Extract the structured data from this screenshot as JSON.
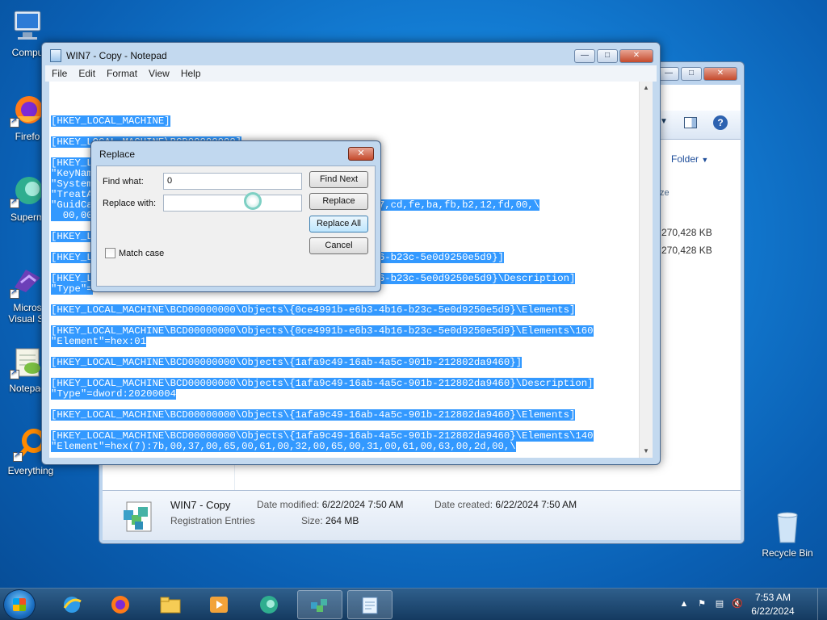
{
  "desktop": {
    "icons": [
      {
        "label": "Compu",
        "icon": "computer-icon"
      },
      {
        "label": "Firefo",
        "icon": "firefox-icon"
      },
      {
        "label": "Superm",
        "icon": "supermium-icon"
      },
      {
        "label": "Micros",
        "label2": "Visual St",
        "icon": "visual-studio-icon"
      },
      {
        "label": "Notepad",
        "icon": "notepad-plus-icon"
      },
      {
        "label": "Everything",
        "icon": "everything-icon"
      },
      {
        "label": "Recycle Bin",
        "icon": "recycle-bin-icon"
      }
    ]
  },
  "explorer": {
    "toolbar_folder": "Folder",
    "size_header": "ze",
    "rows": [
      "270,428 KB",
      "270,428 KB"
    ],
    "details": {
      "name": "WIN7 - Copy",
      "type": "Registration Entries",
      "modified_label": "Date modified:",
      "modified": "6/22/2024 7:50 AM",
      "created_label": "Date created:",
      "created": "6/22/2024 7:50 AM",
      "size_label": "Size:",
      "size": "264 MB"
    }
  },
  "notepad": {
    "title": "WIN7 - Copy - Notepad",
    "menu": [
      "File",
      "Edit",
      "Format",
      "View",
      "Help"
    ],
    "lines": [
      "",
      "[HKEY_LOCAL_MACHINE]",
      "",
      "[HKEY_LOCAL_MACHINE\\BCD00000000]",
      "",
      "[HKEY_L",
      "\"KeyNam",
      "\"System",
      "\"TreatA",
      "\"GuidCa                                              ,a7,cd,fe,ba,fb,b2,12,fd,00,\\",
      "  00,00",
      "",
      "[HKEY_L",
      "",
      "[HKEY_L                                         6b3-4b16-b23c-5e0d9250e5d9}]",
      "",
      "[HKEY_L                                         6b3-4b16-b23c-5e0d9250e5d9}\\Description]",
      "\"Type\"=",
      "",
      "[HKEY_LOCAL_MACHINE\\BCD00000000\\Objects\\{0ce4991b-e6b3-4b16-b23c-5e0d9250e5d9}\\Elements]",
      "",
      "[HKEY_LOCAL_MACHINE\\BCD00000000\\Objects\\{0ce4991b-e6b3-4b16-b23c-5e0d9250e5d9}\\Elements\\160",
      "\"Element\"=hex:01",
      "",
      "[HKEY_LOCAL_MACHINE\\BCD00000000\\Objects\\{1afa9c49-16ab-4a5c-901b-212802da9460}]",
      "",
      "[HKEY_LOCAL_MACHINE\\BCD00000000\\Objects\\{1afa9c49-16ab-4a5c-901b-212802da9460}\\Description]",
      "\"Type\"=dword:20200004",
      "",
      "[HKEY_LOCAL_MACHINE\\BCD00000000\\Objects\\{1afa9c49-16ab-4a5c-901b-212802da9460}\\Elements]",
      "",
      "[HKEY_LOCAL_MACHINE\\BCD00000000\\Objects\\{1afa9c49-16ab-4a5c-901b-212802da9460}\\Elements\\140",
      "\"Element\"=hex(7):7b,00,37,00,65,00,61,00,32,00,65,00,31,00,61,00,63,00,2d,00,\\"
    ]
  },
  "replace_dialog": {
    "title": "Replace",
    "find_label": "Find what:",
    "find_value": "0",
    "replace_label": "Replace with:",
    "replace_value": "",
    "match_case_label": "Match case",
    "buttons": {
      "find_next": "Find Next",
      "replace": "Replace",
      "replace_all": "Replace All",
      "cancel": "Cancel"
    }
  },
  "taskbar": {
    "time": "7:53 AM",
    "date": "6/22/2024"
  },
  "colors": {
    "selection": "#3399ff",
    "accent": "#1b6fc2"
  }
}
